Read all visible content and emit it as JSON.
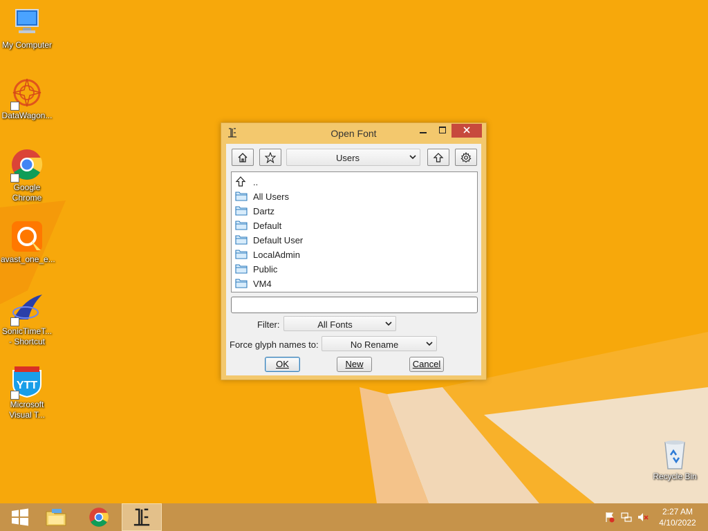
{
  "desktop": {
    "icons": [
      {
        "label": "My Computer",
        "icon": "computer-icon"
      },
      {
        "label": "DataWagon...",
        "icon": "datawagon-icon"
      },
      {
        "label": "Google Chrome",
        "icon": "chrome-icon"
      },
      {
        "label": "avast_one_e...",
        "icon": "avast-icon"
      },
      {
        "label": "SonicTimeT... - Shortcut",
        "icon": "sonic-icon"
      },
      {
        "label": "Microsoft Visual T...",
        "icon": "ytt-icon"
      }
    ],
    "recycle_bin": {
      "label": "Recycle Bin",
      "icon": "recycle-bin-icon"
    }
  },
  "dialog": {
    "title": "Open Font",
    "directory": "Users",
    "entries": [
      {
        "name": "..",
        "icon": "up-arrow-icon"
      },
      {
        "name": "All Users",
        "icon": "folder-icon"
      },
      {
        "name": "Dartz",
        "icon": "folder-icon"
      },
      {
        "name": "Default",
        "icon": "folder-icon"
      },
      {
        "name": "Default User",
        "icon": "folder-icon"
      },
      {
        "name": "LocalAdmin",
        "icon": "folder-icon"
      },
      {
        "name": "Public",
        "icon": "folder-icon"
      },
      {
        "name": "VM4",
        "icon": "folder-icon"
      }
    ],
    "filename_value": "",
    "filter_label": "Filter:",
    "filter_value": "All Fonts",
    "rename_label": "Force glyph names to:",
    "rename_value": "No Rename",
    "buttons": {
      "ok": "OK",
      "new": "New",
      "cancel": "Cancel"
    }
  },
  "taskbar": {
    "items": [
      "start-icon",
      "file-explorer-icon",
      "chrome-icon",
      "fontforge-icon"
    ],
    "time": "2:27 AM",
    "date": "4/10/2022"
  },
  "colors": {
    "desktop_orange": "#f7a80b",
    "taskbar": "#c6934a",
    "dialog_frame": "#f3c86d",
    "close_button": "#c74a3d"
  }
}
